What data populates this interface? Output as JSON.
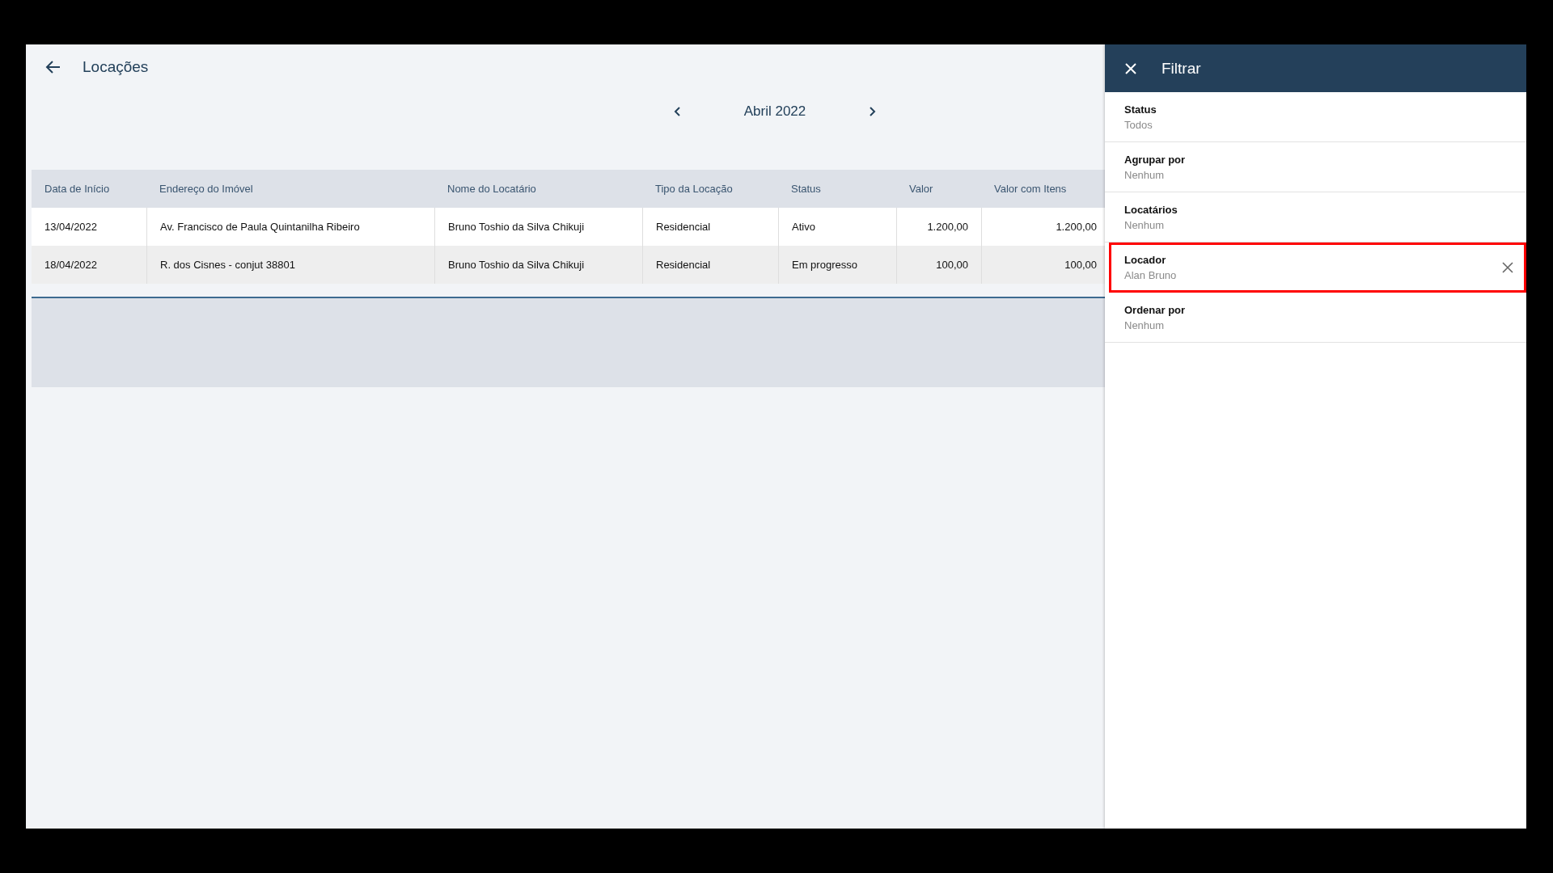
{
  "page": {
    "title": "Locações"
  },
  "period": {
    "label": "Abril 2022"
  },
  "table": {
    "columns": [
      {
        "label": "Data de Início",
        "kind": "text"
      },
      {
        "label": "Endereço do Imóvel",
        "kind": "text"
      },
      {
        "label": "Nome do Locatário",
        "kind": "text"
      },
      {
        "label": "Tipo da Locação",
        "kind": "text"
      },
      {
        "label": "Status",
        "kind": "text"
      },
      {
        "label": "Valor",
        "kind": "money"
      },
      {
        "label": "Valor com Itens",
        "kind": "money"
      }
    ],
    "rows": [
      {
        "cells": [
          "13/04/2022",
          "Av. Francisco de Paula Quintanilha Ribeiro",
          "Bruno Toshio da Silva Chikuji",
          "Residencial",
          "Ativo",
          "1.200,00",
          "1.200,00"
        ]
      },
      {
        "cells": [
          "18/04/2022",
          "R. dos Cisnes - conjut 38801",
          "Bruno Toshio da Silva Chikuji",
          "Residencial",
          "Em progresso",
          "100,00",
          "100,00"
        ]
      }
    ]
  },
  "filter_panel": {
    "title": "Filtrar",
    "items": [
      {
        "label": "Status",
        "value": "Todos",
        "clearable": false,
        "highlighted": false
      },
      {
        "label": "Agrupar por",
        "value": "Nenhum",
        "clearable": false,
        "highlighted": false
      },
      {
        "label": "Locatários",
        "value": "Nenhum",
        "clearable": false,
        "highlighted": false
      },
      {
        "label": "Locador",
        "value": "Alan Bruno",
        "clearable": true,
        "highlighted": true
      },
      {
        "label": "Ordenar por",
        "value": "Nenhum",
        "clearable": false,
        "highlighted": false
      }
    ]
  }
}
